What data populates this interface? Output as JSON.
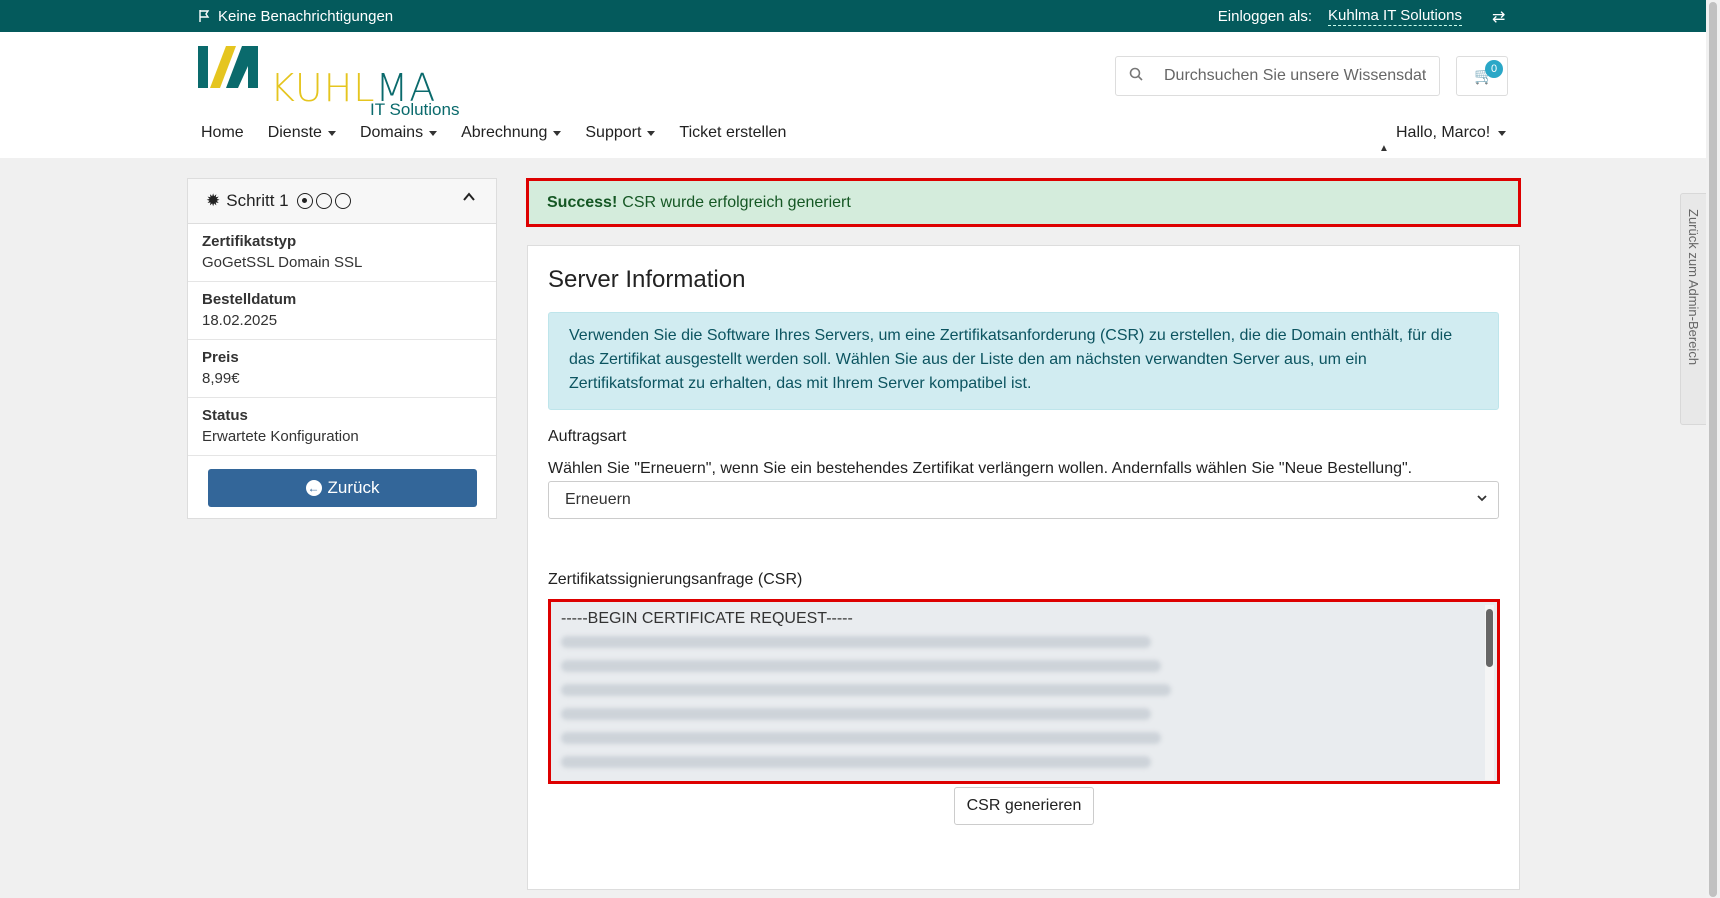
{
  "topbar": {
    "notifications": "Keine Benachrichtigungen",
    "login_label": "Einloggen als:",
    "company": "Kuhlma IT Solutions"
  },
  "logo": {
    "word_k": "KUHL",
    "word_m": "MA",
    "sub": "IT Solutions"
  },
  "search": {
    "placeholder": "Durchsuchen Sie unsere Wissensdatenbank..."
  },
  "cart": {
    "count": "0"
  },
  "nav": {
    "items": [
      {
        "label": "Home"
      },
      {
        "label": "Dienste"
      },
      {
        "label": "Domains"
      },
      {
        "label": "Abrechnung"
      },
      {
        "label": "Support"
      },
      {
        "label": "Ticket erstellen"
      }
    ],
    "hello": "Hallo, Marco!"
  },
  "sidebar": {
    "step": "Schritt 1",
    "rows": [
      {
        "label": "Zertifikatstyp",
        "value": "GoGetSSL Domain SSL"
      },
      {
        "label": "Bestelldatum",
        "value": "18.02.2025"
      },
      {
        "label": "Preis",
        "value": "8,99€"
      },
      {
        "label": "Status",
        "value": "Erwartete Konfiguration"
      }
    ],
    "back": "Zurück"
  },
  "alert": {
    "strong": "Success!",
    "text": "CSR wurde erfolgreich generiert"
  },
  "main": {
    "title": "Server Information",
    "info": "Verwenden Sie die Software Ihres Servers, um eine Zertifikatsanforderung (CSR) zu erstellen, die die Domain enthält, für die das Zertifikat ausgestellt werden soll. Wählen Sie aus der Liste den am nächsten verwandten Server aus, um ein Zertifikatsformat zu erhalten, das mit Ihrem Server kompatibel ist.",
    "order_label": "Auftragsart",
    "order_desc": "Wählen Sie \"Erneuern\", wenn Sie ein bestehendes Zertifikat verlängern wollen. Andernfalls wählen Sie \"Neue Bestellung\".",
    "order_value": "Erneuern",
    "csr_label": "Zertifikatssignierungsanfrage (CSR)",
    "csr_begin": "-----BEGIN CERTIFICATE REQUEST-----",
    "csr_button": "CSR generieren"
  },
  "admin_tab": "Zurück zum Admin-Bereich",
  "colors": {
    "topbar": "#045a5c",
    "accent": "#336699",
    "logo_yellow": "#e5c51f",
    "logo_teal": "#0a6a6c",
    "highlight": "#dd0000"
  }
}
